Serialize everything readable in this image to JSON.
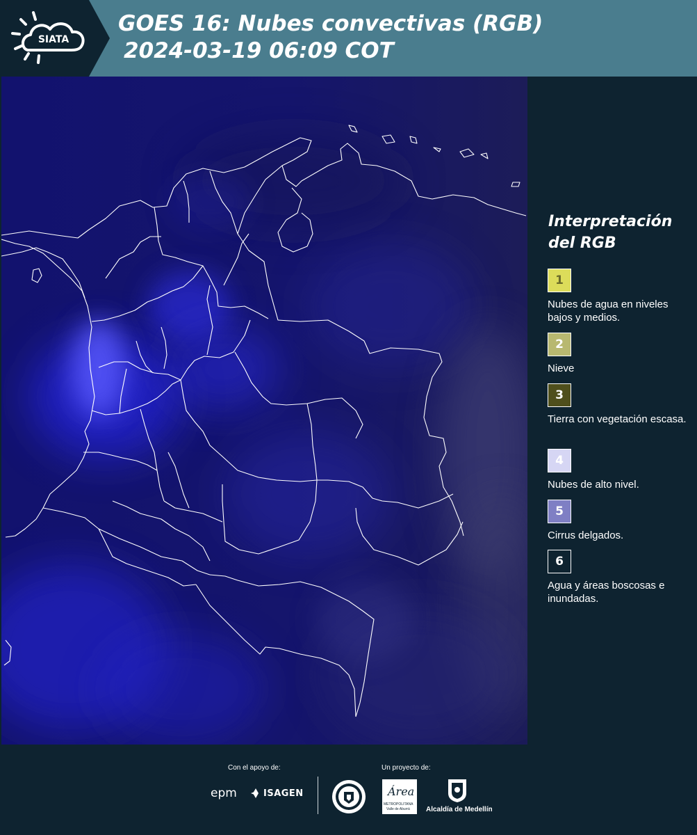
{
  "header": {
    "logo_text": "SIATA",
    "title_line1": "GOES 16: Nubes convectivas (RGB)",
    "title_line2": "2024-03-19 06:09 COT",
    "background_color": "#4a7d8e"
  },
  "legend": {
    "title": "Interpretación del RGB",
    "items": [
      {
        "number": "1",
        "label": "Nubes de agua en niveles bajos y medios.",
        "color": "#dcdc5a",
        "text_color": "#6b6b2a"
      },
      {
        "number": "2",
        "label": "Nieve",
        "color": "#b8b870",
        "text_color": "#ffffff"
      },
      {
        "number": "3",
        "label": "Tierra con vegetación escasa.",
        "color": "#4f4f1c",
        "text_color": "#ffffff"
      },
      {
        "number": "4",
        "label": "Nubes de alto nivel.",
        "color": "#d6d6f4",
        "text_color": "#ffffff"
      },
      {
        "number": "5",
        "label": "Cirrus delgados.",
        "color": "#7f7fc4",
        "text_color": "#ffffff"
      },
      {
        "number": "6",
        "label": "Agua y áreas boscosas e inundadas.",
        "color": "#0e2330",
        "text_color": "#ffffff"
      }
    ]
  },
  "footer": {
    "support_label": "Con el apoyo de:",
    "project_label": "Un proyecto de:",
    "sponsor_logos": [
      "epm",
      "ISAGEN"
    ],
    "project_logos": [
      "Universidad de Medellín",
      "Área Metropolitana Valle de Aburrá",
      "Alcaldía de Medellín"
    ],
    "area_logo_text": "Área",
    "area_logo_subtitle": "METROPOLITANA",
    "area_logo_subtitle2": "Valle de Aburrá",
    "alcaldia_logo_text": "Alcaldía de Medellín"
  }
}
